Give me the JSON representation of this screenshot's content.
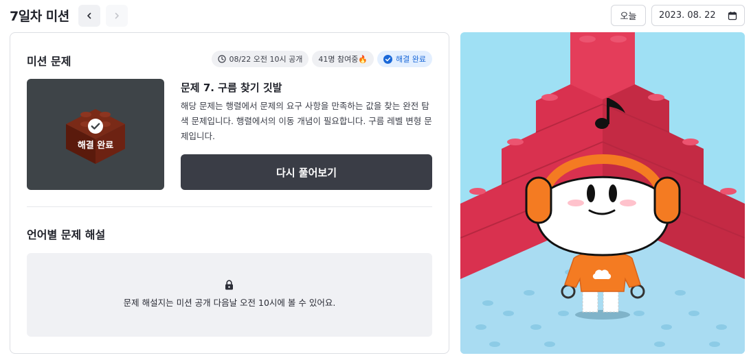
{
  "header": {
    "title": "7일차 미션",
    "today_label": "오늘",
    "date": "2023. 08. 22"
  },
  "mission": {
    "section_title": "미션 문제",
    "badges": {
      "open_time": "08/22 오전 10시 공개",
      "participants": "41명 참여중🔥",
      "status": "해결 완료"
    },
    "thumbnail_label": "해결 완료",
    "problem_title": "문제 7. 구름 찾기 깃발",
    "problem_description": "해당 문제는 행렬에서 문제의 요구 사항을 만족하는 값을 찾는 완전 탐색 문제입니다. 행렬에서의 이동 개념이 필요합니다. 구름 레벨 변형 문제입니다.",
    "retry_button": "다시 풀어보기"
  },
  "solutions": {
    "section_title": "언어별 문제 해설",
    "locked_message": "문제 해설지는 미션 공개 다음날 오전 10시에 볼 수 있어요."
  },
  "colors": {
    "accent": "#1a68d8",
    "dark_button": "#3a3d46",
    "brick_red": "#d9314f",
    "floor_blue": "#a9dcf2",
    "sky_blue": "#9fe0f4",
    "character_orange": "#f47b22"
  },
  "icons": [
    "chevron-left-icon",
    "chevron-right-icon",
    "calendar-icon",
    "clock-icon",
    "check-circle-icon",
    "lock-icon"
  ]
}
